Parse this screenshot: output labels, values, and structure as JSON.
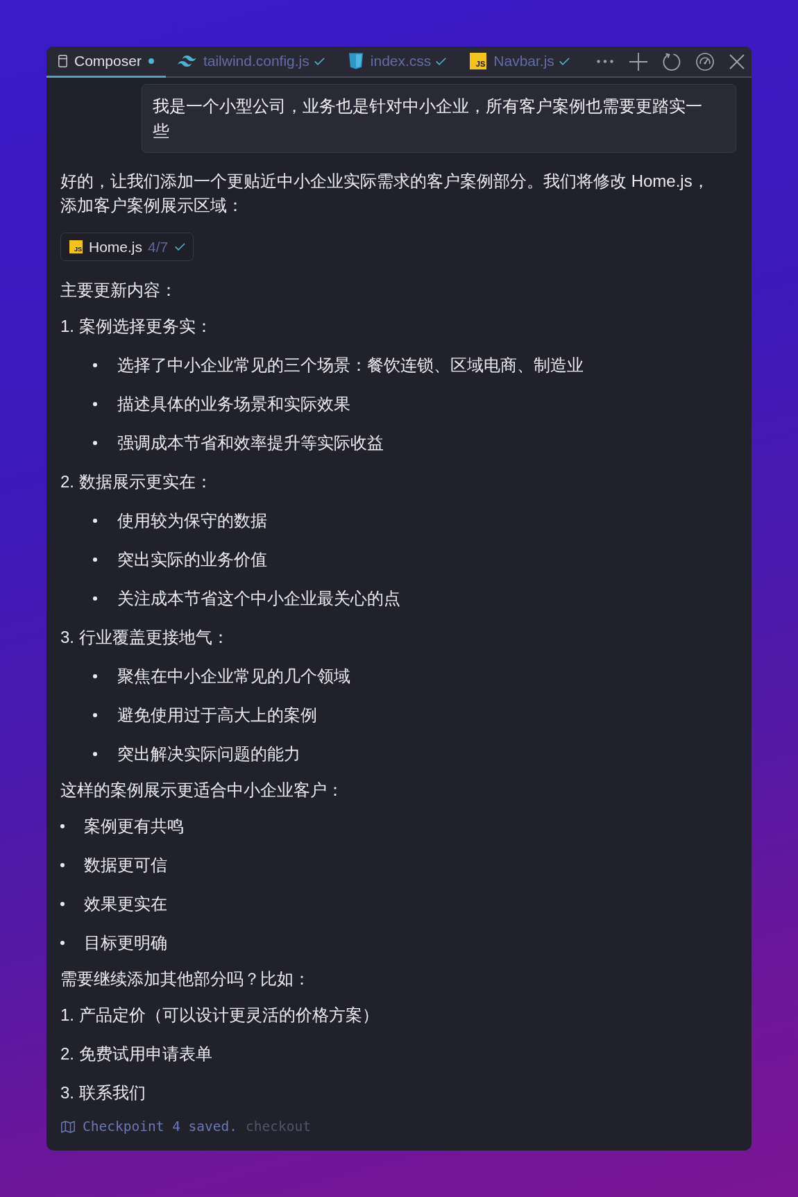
{
  "tabs": [
    {
      "label": "Composer",
      "kind": "composer",
      "unsaved": true,
      "applied": false,
      "selected": true
    },
    {
      "label": "tailwind.config.js",
      "kind": "tailwind",
      "unsaved": false,
      "applied": true,
      "selected": false
    },
    {
      "label": "index.css",
      "kind": "css",
      "unsaved": false,
      "applied": true,
      "selected": false
    },
    {
      "label": "Navbar.js",
      "kind": "js",
      "badge": "JS",
      "unsaved": false,
      "applied": true,
      "selected": false
    }
  ],
  "user_message": {
    "text": "我是一个小型公司，业务也是针对中小企业，所有客户案例也需要更踏实一些"
  },
  "reply": [
    {
      "kind": "paragraph",
      "text": "好的，让我们添加一个更贴近中小企业实际需求的客户案例部分。我们将修改 Home.js，添加客户案例展示区域："
    },
    {
      "kind": "file",
      "badge": "JS",
      "name": "Home.js",
      "progress": "4/7",
      "applied": true
    },
    {
      "kind": "paragraph",
      "text": "主要更新内容："
    },
    {
      "kind": "numbered",
      "text": "1. 案例选择更务实：",
      "children": [
        {
          "text": "选择了中小企业常见的三个场景：餐饮连锁、区域电商、制造业"
        },
        {
          "text": "描述具体的业务场景和实际效果"
        },
        {
          "text": "强调成本节省和效率提升等实际收益"
        }
      ]
    },
    {
      "kind": "numbered",
      "text": "2. 数据展示更实在：",
      "children": [
        {
          "text": "使用较为保守的数据"
        },
        {
          "text": "突出实际的业务价值"
        },
        {
          "text": "关注成本节省这个中小企业最关心的点"
        }
      ]
    },
    {
      "kind": "numbered",
      "text": "3. 行业覆盖更接地气：",
      "children": [
        {
          "text": "聚焦在中小企业常见的几个领域"
        },
        {
          "text": "避免使用过于高大上的案例"
        },
        {
          "text": "突出解决实际问题的能力"
        }
      ]
    },
    {
      "kind": "paragraph",
      "text": "这样的案例展示更适合中小企业客户："
    },
    {
      "kind": "bullet",
      "text": "案例更有共鸣"
    },
    {
      "kind": "bullet",
      "text": "数据更可信"
    },
    {
      "kind": "bullet",
      "text": "效果更实在"
    },
    {
      "kind": "bullet",
      "text": "目标更明确"
    },
    {
      "kind": "paragraph",
      "text": "需要继续添加其他部分吗？比如："
    },
    {
      "kind": "numbered",
      "text": "1. 产品定价（可以设计更灵活的价格方案）"
    },
    {
      "kind": "numbered",
      "text": "2. 免费试用申请表单"
    },
    {
      "kind": "numbered",
      "text": "3. 联系我们"
    }
  ],
  "checkpoint": {
    "text": "Checkpoint 4 saved.",
    "action": "checkout"
  }
}
